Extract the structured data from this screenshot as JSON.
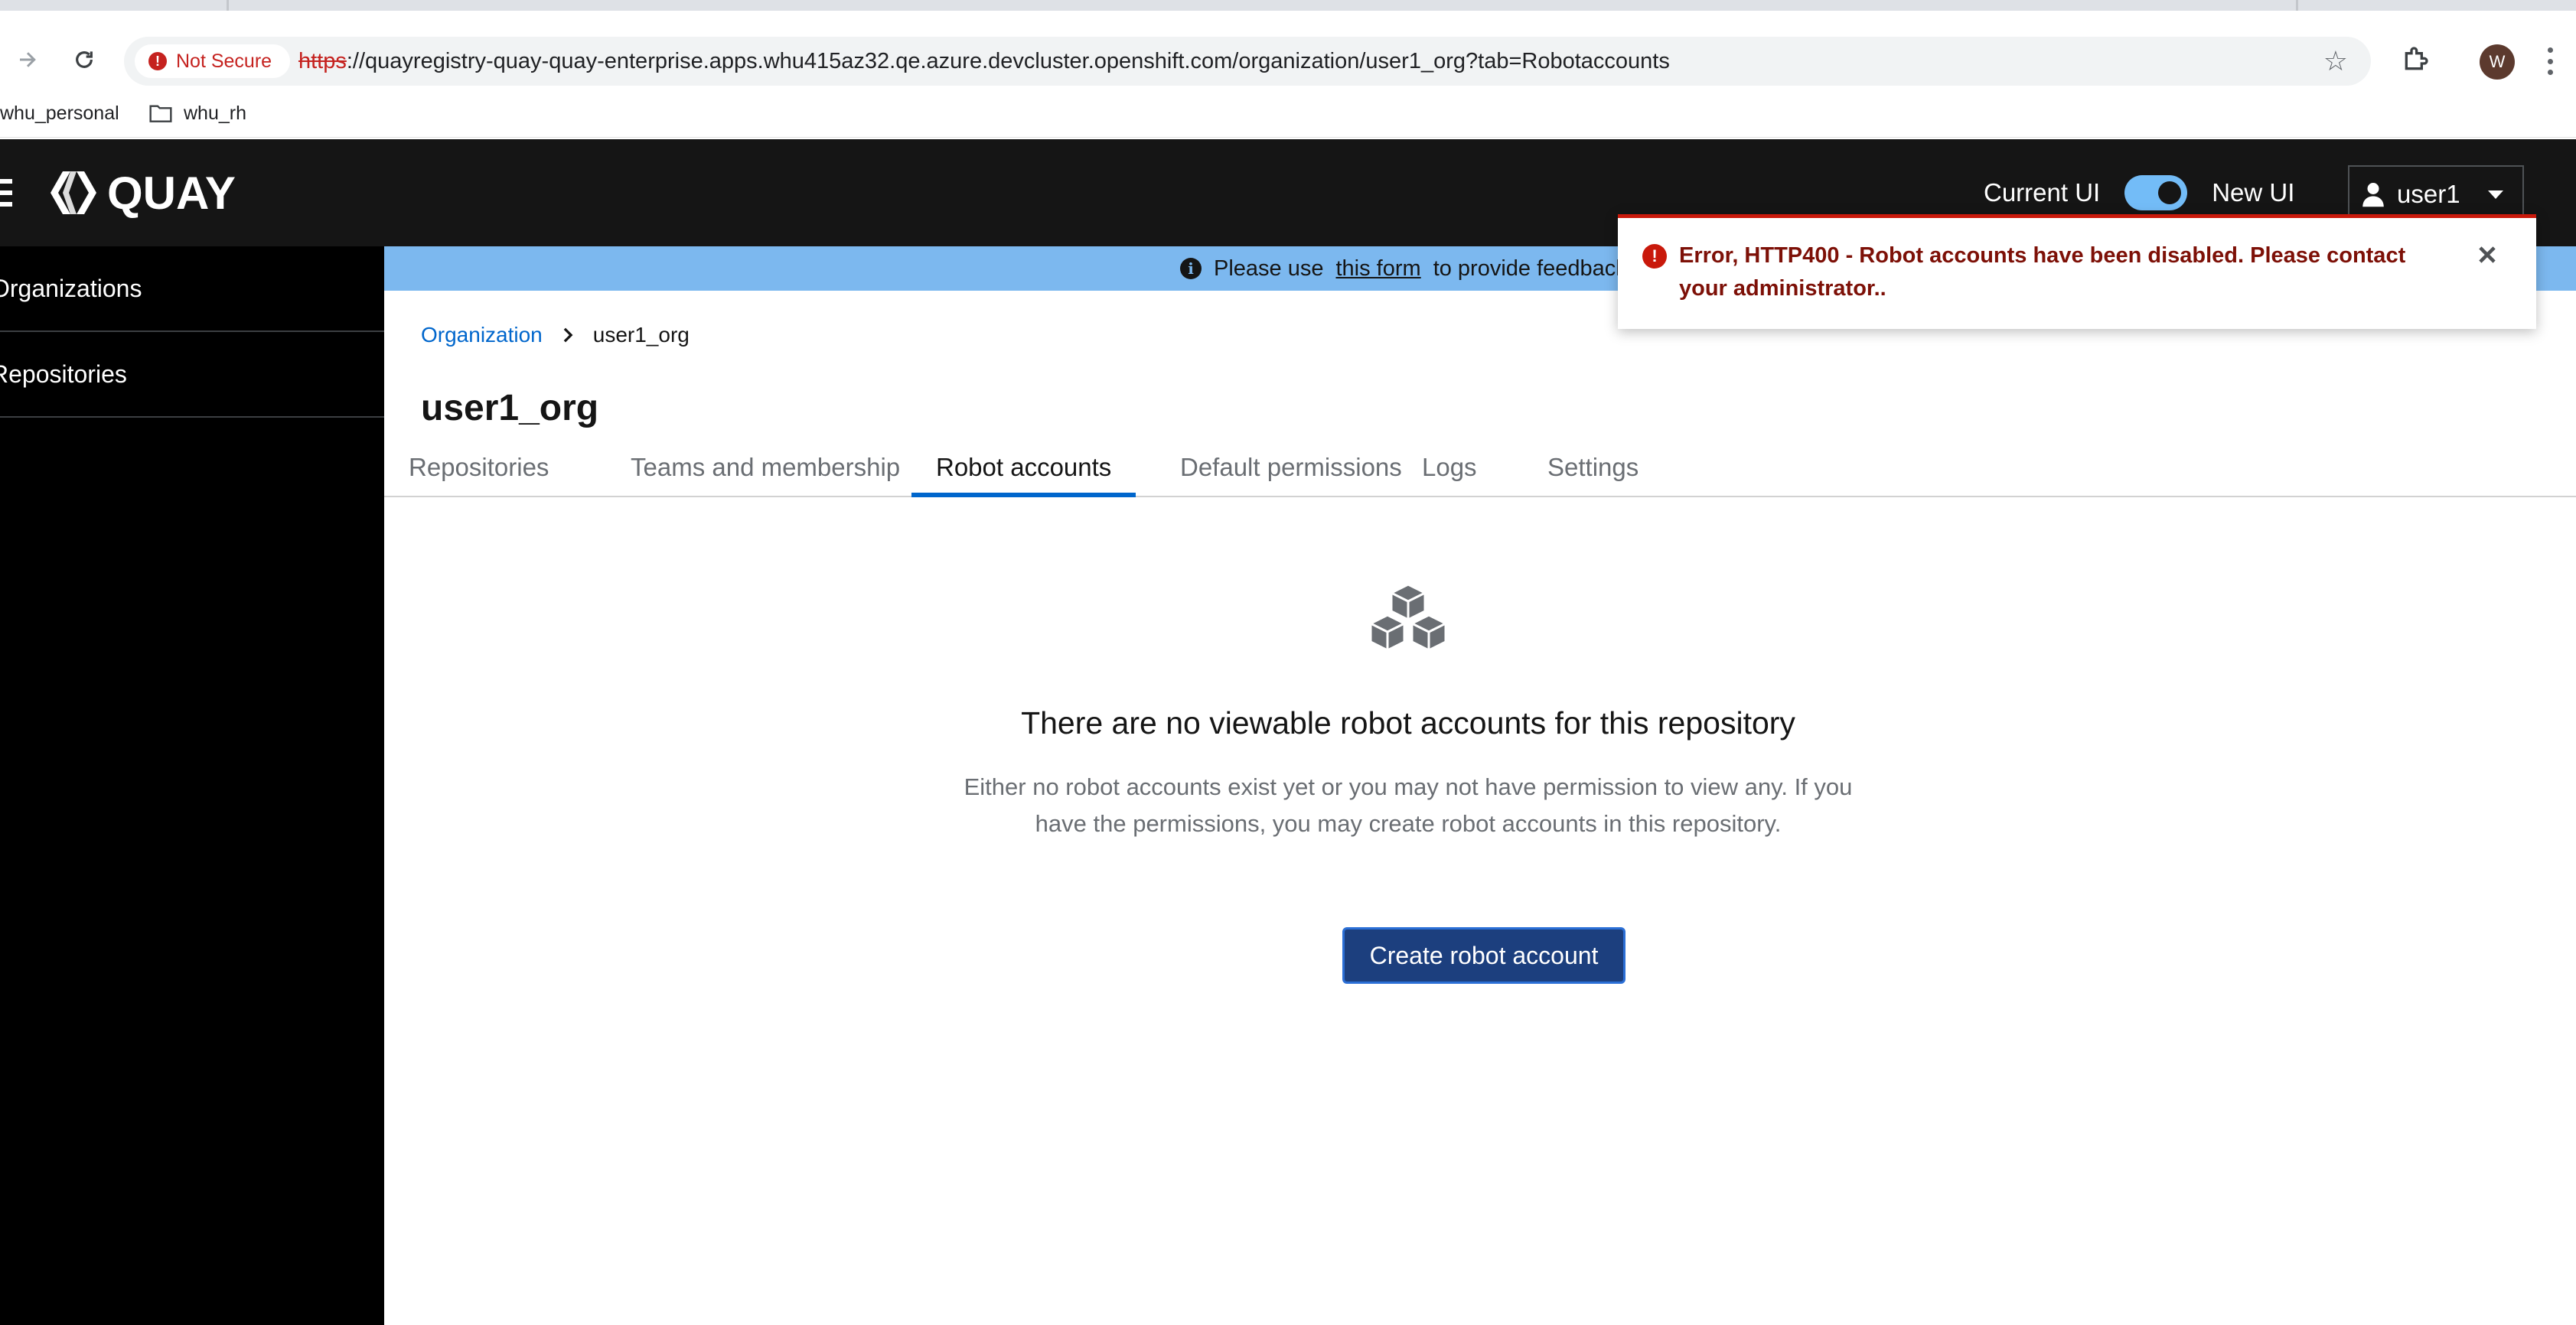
{
  "browser": {
    "security_label": "Not Secure",
    "url_scheme": "https",
    "url_rest": "://quayregistry-quay-quay-enterprise.apps.whu415az32.qe.azure.devcluster.openshift.com/organization/user1_org?tab=Robotaccounts",
    "profile_initial": "W",
    "bookmarks": [
      {
        "label": "whu_personal"
      },
      {
        "label": "whu_rh"
      }
    ]
  },
  "header": {
    "logo_text": "QUAY",
    "current_ui_label": "Current UI",
    "new_ui_label": "New UI",
    "toggle_on": true,
    "user_label": "user1"
  },
  "sidebar": {
    "items": [
      {
        "label": "Organizations"
      },
      {
        "label": "Repositories"
      }
    ]
  },
  "banner": {
    "text_before": "Please use",
    "link_text": "this form",
    "text_after": "to provide feedback o"
  },
  "breadcrumb": {
    "parent": "Organization",
    "current": "user1_org"
  },
  "page": {
    "title": "user1_org",
    "tabs": [
      {
        "label": "Repositories",
        "active": false
      },
      {
        "label": "Teams and membership",
        "active": false
      },
      {
        "label": "Robot accounts",
        "active": true
      },
      {
        "label": "Default permissions",
        "active": false
      },
      {
        "label": "Logs",
        "active": false
      },
      {
        "label": "Settings",
        "active": false
      }
    ]
  },
  "empty_state": {
    "icon": "cubes-icon",
    "title": "There are no viewable robot accounts for this repository",
    "body": "Either no robot accounts exist yet or you may not have permission to view any. If you have the permissions, you may create robot accounts in this repository.",
    "button_label": "Create robot account"
  },
  "alert": {
    "variant": "danger",
    "message": "Error, HTTP400 - Robot accounts have been disabled. Please contact your administrator.."
  },
  "colors": {
    "header_bg": "#151515",
    "sidebar_bg": "#000000",
    "banner_bg": "#7cb8ef",
    "active_tab": "#0066cc",
    "primary_button": "#1c3f7e",
    "danger": "#c9190b"
  }
}
